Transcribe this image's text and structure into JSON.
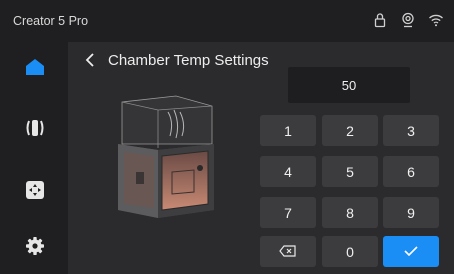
{
  "header": {
    "app_title": "Creator 5 Pro"
  },
  "status_icons": [
    "lock-icon",
    "camera-icon",
    "wifi-icon"
  ],
  "sidebar": {
    "items": [
      "home-icon",
      "filament-icon",
      "move-icon",
      "settings-icon"
    ],
    "active": "home-icon"
  },
  "page": {
    "title": "Chamber Temp Settings"
  },
  "input": {
    "value": "50"
  },
  "keypad": {
    "keys": [
      "1",
      "2",
      "3",
      "4",
      "5",
      "6",
      "7",
      "8",
      "9",
      "0"
    ]
  },
  "colors": {
    "accent": "#1a8ef5",
    "background": "#2b2b2d",
    "panel": "#1f1f21",
    "key": "#3c3c3e"
  }
}
